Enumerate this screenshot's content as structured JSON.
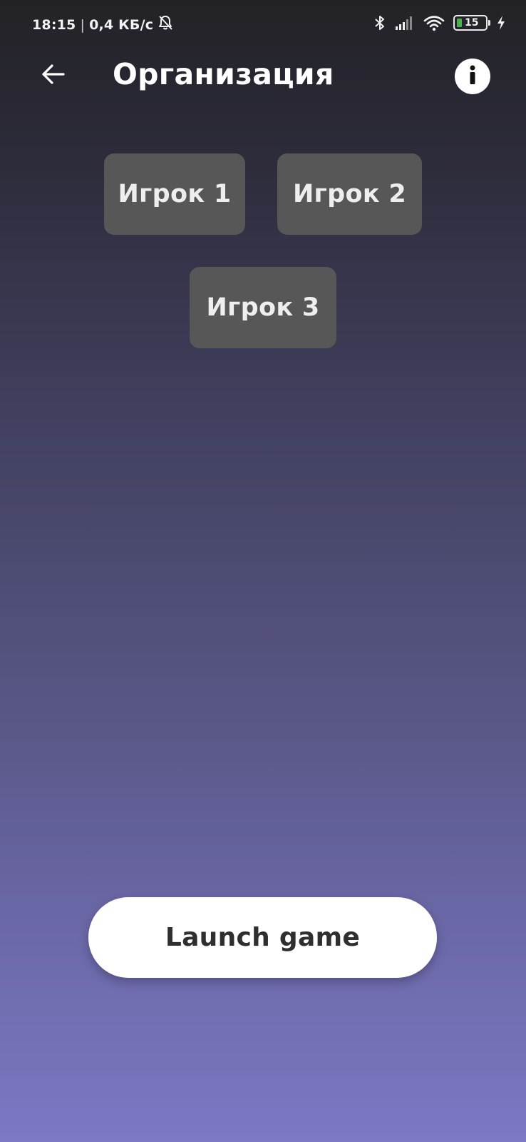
{
  "status_bar": {
    "time": "18:15",
    "separator": "|",
    "network_speed": "0,4 КБ/с",
    "icons": [
      "bell-off-icon",
      "bluetooth-icon",
      "signal-icon",
      "wifi-icon",
      "battery-icon",
      "charging-icon"
    ],
    "battery_level": "15",
    "battery_color": "#4caf50"
  },
  "header": {
    "back_icon": "arrow-left-icon",
    "title": "Организация",
    "info_icon": "info-icon"
  },
  "players": [
    {
      "label": "Игрок 1"
    },
    {
      "label": "Игрок 2"
    },
    {
      "label": "Игрок 3"
    }
  ],
  "launch": {
    "label": "Launch game"
  },
  "colors": {
    "chip_bg": "#575757",
    "gradient_top": "#222226",
    "gradient_bottom": "#7c78c4",
    "button_bg": "#ffffff"
  }
}
